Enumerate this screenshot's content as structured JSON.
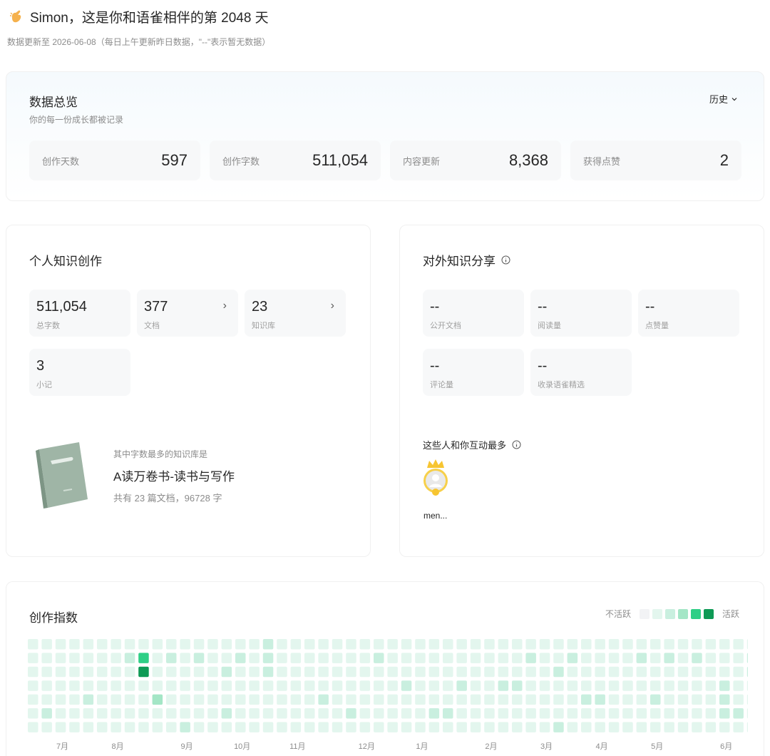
{
  "header": {
    "greeting": "Simon，这是你和语雀相伴的第 2048 天",
    "subtitle": "数据更新至 2026-06-08（每日上午更新昨日数据，\"--\"表示暂无数据）"
  },
  "overview": {
    "title": "数据总览",
    "subtitle": "你的每一份成长都被记录",
    "history_label": "历史",
    "stats": [
      {
        "label": "创作天数",
        "value": "597"
      },
      {
        "label": "创作字数",
        "value": "511,054"
      },
      {
        "label": "内容更新",
        "value": "8,368"
      },
      {
        "label": "获得点赞",
        "value": "2"
      }
    ]
  },
  "personal": {
    "title": "个人知识创作",
    "metrics": [
      {
        "value": "511,054",
        "label": "总字数",
        "arrow": ""
      },
      {
        "value": "377",
        "label": "文档",
        "arrow": "›"
      },
      {
        "value": "23",
        "label": "知识库",
        "arrow": "›"
      },
      {
        "value": "3",
        "label": "小记",
        "arrow": ""
      }
    ],
    "library_hint": "其中字数最多的知识库是",
    "library_name": "A读万卷书-读书与写作",
    "library_stat": "共有 23 篇文档，96728 字"
  },
  "share": {
    "title": "对外知识分享",
    "metrics": [
      {
        "value": "--",
        "label": "公开文档"
      },
      {
        "value": "--",
        "label": "阅读量"
      },
      {
        "value": "--",
        "label": "点赞量"
      },
      {
        "value": "--",
        "label": "评论量"
      },
      {
        "value": "--",
        "label": "收录语雀精选"
      }
    ],
    "interact_title": "这些人和你互动最多",
    "top_user": "men..."
  },
  "heatmap": {
    "title": "创作指数",
    "legend_low": "不活跃",
    "legend_high": "活跃",
    "colors": [
      "#f2f3f5",
      "#e3f6ee",
      "#c9efdf",
      "#a4e6c6",
      "#2fcf86",
      "#0e9a55"
    ],
    "months": [
      "7月",
      "8月",
      "9月",
      "10月",
      "11月",
      "12月",
      "1月",
      "2月",
      "3月",
      "4月",
      "5月",
      "6月"
    ],
    "month_weeks": [
      2.5,
      6.5,
      11.5,
      15.5,
      19.5,
      24.5,
      28.5,
      33.5,
      37.5,
      41.5,
      45.5,
      50.5
    ],
    "weeks": [
      [
        1,
        1,
        1,
        1,
        1,
        1,
        1
      ],
      [
        1,
        1,
        1,
        1,
        1,
        2,
        1
      ],
      [
        1,
        1,
        1,
        1,
        1,
        1,
        1
      ],
      [
        1,
        1,
        1,
        1,
        1,
        1,
        1
      ],
      [
        1,
        1,
        1,
        1,
        2,
        1,
        1
      ],
      [
        1,
        1,
        1,
        1,
        1,
        1,
        1
      ],
      [
        1,
        1,
        1,
        1,
        1,
        1,
        1
      ],
      [
        1,
        2,
        1,
        1,
        1,
        1,
        1
      ],
      [
        1,
        4,
        5,
        1,
        1,
        1,
        1
      ],
      [
        1,
        1,
        1,
        1,
        3,
        1,
        1
      ],
      [
        1,
        2,
        1,
        1,
        1,
        1,
        1
      ],
      [
        1,
        1,
        1,
        1,
        1,
        1,
        2
      ],
      [
        1,
        2,
        1,
        1,
        1,
        1,
        1
      ],
      [
        1,
        1,
        1,
        1,
        1,
        1,
        1
      ],
      [
        1,
        1,
        2,
        1,
        1,
        2,
        1
      ],
      [
        1,
        2,
        1,
        1,
        1,
        1,
        1
      ],
      [
        1,
        1,
        1,
        1,
        1,
        1,
        1
      ],
      [
        2,
        2,
        2,
        1,
        1,
        1,
        1
      ],
      [
        1,
        1,
        1,
        1,
        1,
        1,
        1
      ],
      [
        1,
        1,
        1,
        1,
        1,
        1,
        1
      ],
      [
        1,
        1,
        1,
        1,
        1,
        1,
        1
      ],
      [
        1,
        1,
        1,
        1,
        2,
        1,
        1
      ],
      [
        1,
        1,
        1,
        1,
        1,
        1,
        1
      ],
      [
        1,
        1,
        1,
        1,
        1,
        2,
        1
      ],
      [
        1,
        1,
        1,
        1,
        1,
        1,
        1
      ],
      [
        1,
        2,
        1,
        1,
        1,
        1,
        1
      ],
      [
        1,
        1,
        1,
        1,
        1,
        1,
        1
      ],
      [
        1,
        1,
        1,
        2,
        1,
        1,
        1
      ],
      [
        1,
        1,
        1,
        1,
        1,
        1,
        1
      ],
      [
        1,
        1,
        1,
        1,
        1,
        2,
        1
      ],
      [
        1,
        1,
        1,
        1,
        1,
        2,
        1
      ],
      [
        1,
        1,
        1,
        2,
        1,
        1,
        1
      ],
      [
        1,
        1,
        1,
        1,
        1,
        1,
        1
      ],
      [
        1,
        1,
        1,
        1,
        1,
        1,
        1
      ],
      [
        1,
        1,
        1,
        2,
        1,
        1,
        1
      ],
      [
        1,
        1,
        1,
        2,
        1,
        1,
        1
      ],
      [
        1,
        2,
        1,
        1,
        1,
        1,
        1
      ],
      [
        1,
        1,
        1,
        1,
        1,
        1,
        1
      ],
      [
        1,
        1,
        2,
        1,
        1,
        1,
        2
      ],
      [
        1,
        2,
        1,
        1,
        1,
        1,
        1
      ],
      [
        1,
        1,
        1,
        1,
        2,
        1,
        1
      ],
      [
        1,
        1,
        1,
        1,
        2,
        1,
        1
      ],
      [
        1,
        1,
        1,
        1,
        1,
        1,
        1
      ],
      [
        1,
        1,
        1,
        1,
        1,
        1,
        1
      ],
      [
        1,
        2,
        1,
        1,
        1,
        1,
        1
      ],
      [
        1,
        1,
        1,
        1,
        2,
        1,
        1
      ],
      [
        1,
        2,
        1,
        1,
        1,
        1,
        1
      ],
      [
        1,
        1,
        1,
        1,
        1,
        1,
        1
      ],
      [
        1,
        2,
        1,
        1,
        1,
        1,
        1
      ],
      [
        1,
        1,
        1,
        1,
        1,
        1,
        1
      ],
      [
        1,
        1,
        1,
        2,
        2,
        2,
        1
      ],
      [
        1,
        1,
        1,
        1,
        1,
        2,
        1
      ],
      [
        1,
        2,
        2,
        1,
        1,
        1,
        1
      ]
    ]
  }
}
